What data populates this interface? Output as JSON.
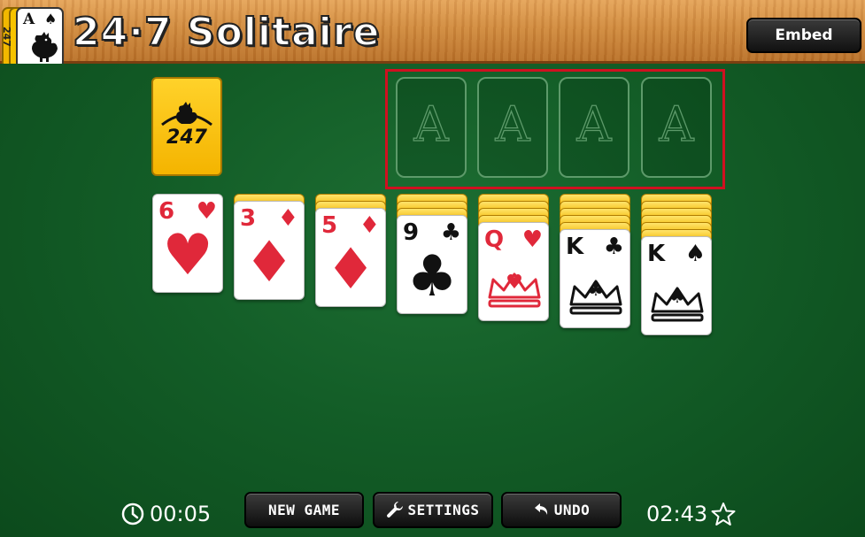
{
  "header": {
    "app_title": "24·7 Solitaire",
    "logo_text": "247",
    "logo_rank": "A",
    "logo_suit": "♠",
    "embed_label": "Embed"
  },
  "stock": {
    "logo_text": "247"
  },
  "foundations": [
    {
      "label": "A"
    },
    {
      "label": "A"
    },
    {
      "label": "A"
    },
    {
      "label": "A"
    }
  ],
  "tableau": [
    {
      "hidden": 0,
      "rank": "6",
      "suit": "♥",
      "color": "red"
    },
    {
      "hidden": 1,
      "rank": "3",
      "suit": "♦",
      "color": "red"
    },
    {
      "hidden": 2,
      "rank": "5",
      "suit": "♦",
      "color": "red"
    },
    {
      "hidden": 3,
      "rank": "9",
      "suit": "♣",
      "color": "black"
    },
    {
      "hidden": 4,
      "rank": "Q",
      "suit": "♥",
      "color": "red"
    },
    {
      "hidden": 5,
      "rank": "K",
      "suit": "♣",
      "color": "black"
    },
    {
      "hidden": 6,
      "rank": "K",
      "suit": "♠",
      "color": "black"
    }
  ],
  "footer": {
    "elapsed_time": "00:05",
    "new_game_label": "NEW GAME",
    "settings_label": "SETTINGS",
    "undo_label": "UNDO",
    "target_time": "02:43"
  },
  "colors": {
    "felt": "#135d27",
    "card_back": "#f4b400",
    "red_suit": "#e0283a",
    "highlight_frame": "#d01020"
  },
  "icons": [
    "clock-icon",
    "wrench-icon",
    "undo-icon",
    "star-icon",
    "rooster-icon"
  ]
}
